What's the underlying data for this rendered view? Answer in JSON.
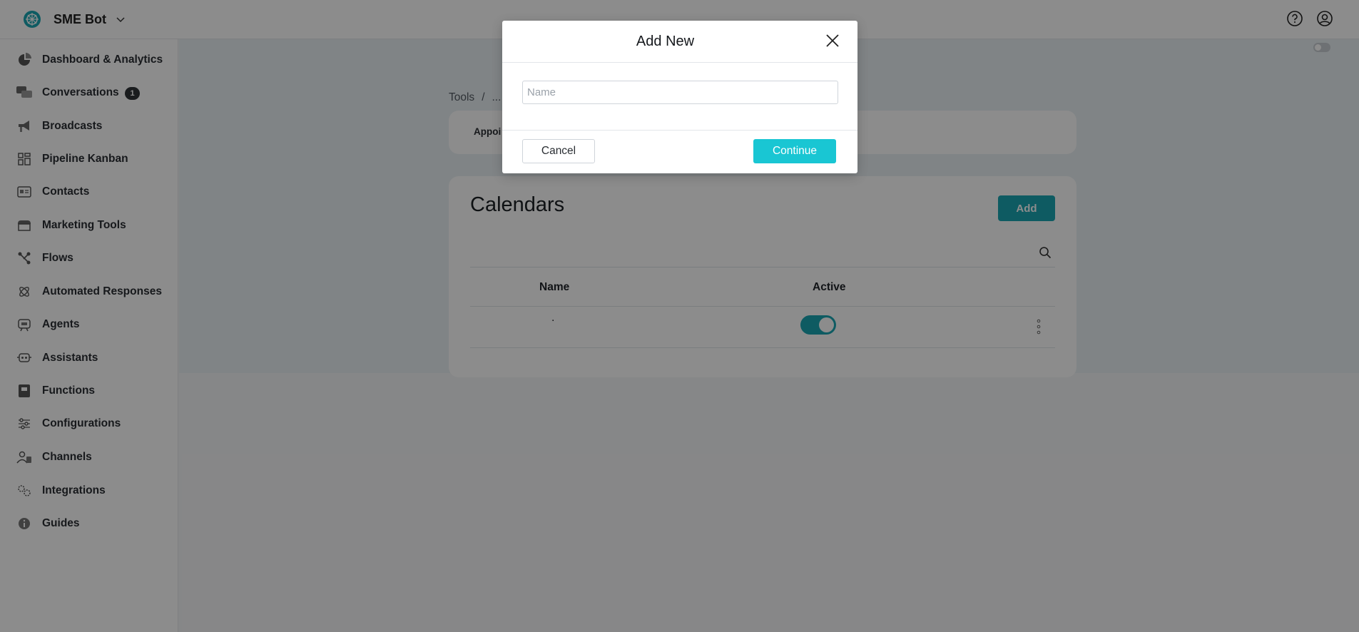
{
  "app": {
    "brand_name": "SME Bot",
    "accent_color": "#19c6d3",
    "teal_color": "#1aa6b3"
  },
  "header": {
    "icons": [
      "help-circle-icon",
      "user-account-icon"
    ]
  },
  "sidebar": {
    "items": [
      {
        "label": "Dashboard & Analytics",
        "icon": "pie-chart-icon"
      },
      {
        "label": "Conversations",
        "icon": "chat-bubbles-icon",
        "badge": "1"
      },
      {
        "label": "Broadcasts",
        "icon": "megaphone-icon"
      },
      {
        "label": "Pipeline Kanban",
        "icon": "kanban-icon"
      },
      {
        "label": "Contacts",
        "icon": "contact-card-icon"
      },
      {
        "label": "Marketing Tools",
        "icon": "storefront-icon"
      },
      {
        "label": "Flows",
        "icon": "flows-icon"
      },
      {
        "label": "Automated Responses",
        "icon": "atom-icon"
      },
      {
        "label": "Agents",
        "icon": "agent-icon"
      },
      {
        "label": "Assistants",
        "icon": "robot-icon"
      },
      {
        "label": "Functions",
        "icon": "function-book-icon"
      },
      {
        "label": "Configurations",
        "icon": "sliders-icon"
      },
      {
        "label": "Channels",
        "icon": "people-icon"
      },
      {
        "label": "Integrations",
        "icon": "gears-icon"
      },
      {
        "label": "Guides",
        "icon": "info-icon"
      }
    ]
  },
  "main": {
    "breadcrumb": {
      "root": "Tools",
      "sep": "/",
      "current": "..."
    },
    "tab_label": "Appoi",
    "calendars": {
      "title": "Calendars",
      "add_label": "Add",
      "columns": {
        "name": "Name",
        "active": "Active"
      },
      "rows": [
        {
          "name": ".",
          "active": true
        }
      ]
    }
  },
  "modal": {
    "title": "Add New",
    "name_placeholder": "Name",
    "name_value": "",
    "cancel_label": "Cancel",
    "continue_label": "Continue"
  }
}
